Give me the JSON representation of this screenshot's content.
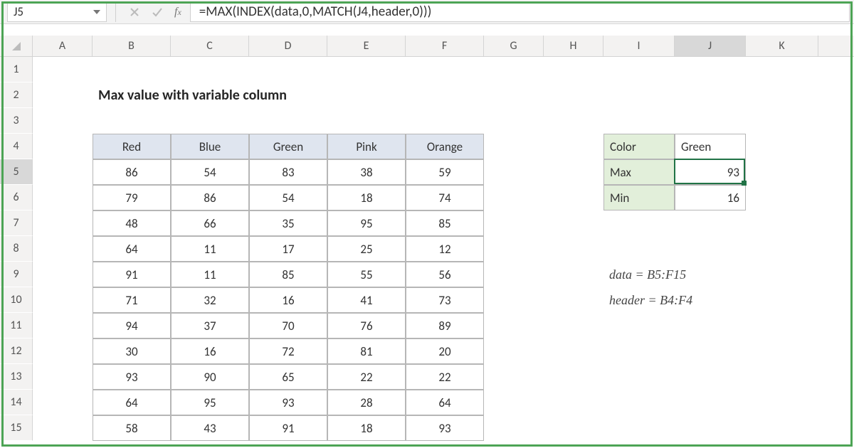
{
  "formula_bar": {
    "name_box": "J5",
    "formula": "=MAX(INDEX(data,0,MATCH(J4,header,0)))"
  },
  "columns": [
    "A",
    "B",
    "C",
    "D",
    "E",
    "F",
    "G",
    "H",
    "I",
    "J",
    "K"
  ],
  "active_col": "J",
  "row_numbers": [
    1,
    2,
    3,
    4,
    5,
    6,
    7,
    8,
    9,
    10,
    11,
    12,
    13,
    14,
    15
  ],
  "active_row": 5,
  "title": "Max value with variable column",
  "table_headers": [
    "Red",
    "Blue",
    "Green",
    "Pink",
    "Orange"
  ],
  "table_rows": [
    [
      86,
      54,
      83,
      38,
      59
    ],
    [
      79,
      86,
      54,
      18,
      74
    ],
    [
      48,
      66,
      35,
      95,
      85
    ],
    [
      64,
      11,
      17,
      25,
      12
    ],
    [
      91,
      11,
      85,
      55,
      56
    ],
    [
      71,
      32,
      16,
      41,
      73
    ],
    [
      94,
      37,
      70,
      76,
      89
    ],
    [
      30,
      16,
      72,
      81,
      20
    ],
    [
      93,
      90,
      65,
      22,
      22
    ],
    [
      64,
      95,
      93,
      28,
      64
    ],
    [
      58,
      43,
      91,
      18,
      93
    ]
  ],
  "side": {
    "color_label": "Color",
    "color_value": "Green",
    "max_label": "Max",
    "max_value": 93,
    "min_label": "Min",
    "min_value": 16
  },
  "notes": {
    "data": "data = B5:F15",
    "header": "header = B4:F4"
  },
  "chart_data": {
    "type": "table",
    "title": "Max value with variable column",
    "categories": [
      "Red",
      "Blue",
      "Green",
      "Pink",
      "Orange"
    ],
    "rows": [
      [
        86,
        54,
        83,
        38,
        59
      ],
      [
        79,
        86,
        54,
        18,
        74
      ],
      [
        48,
        66,
        35,
        95,
        85
      ],
      [
        64,
        11,
        17,
        25,
        12
      ],
      [
        91,
        11,
        85,
        55,
        56
      ],
      [
        71,
        32,
        16,
        41,
        73
      ],
      [
        94,
        37,
        70,
        76,
        89
      ],
      [
        30,
        16,
        72,
        81,
        20
      ],
      [
        93,
        90,
        65,
        22,
        22
      ],
      [
        64,
        95,
        93,
        28,
        64
      ],
      [
        58,
        43,
        91,
        18,
        93
      ]
    ],
    "result": {
      "Color": "Green",
      "Max": 93,
      "Min": 16
    }
  }
}
